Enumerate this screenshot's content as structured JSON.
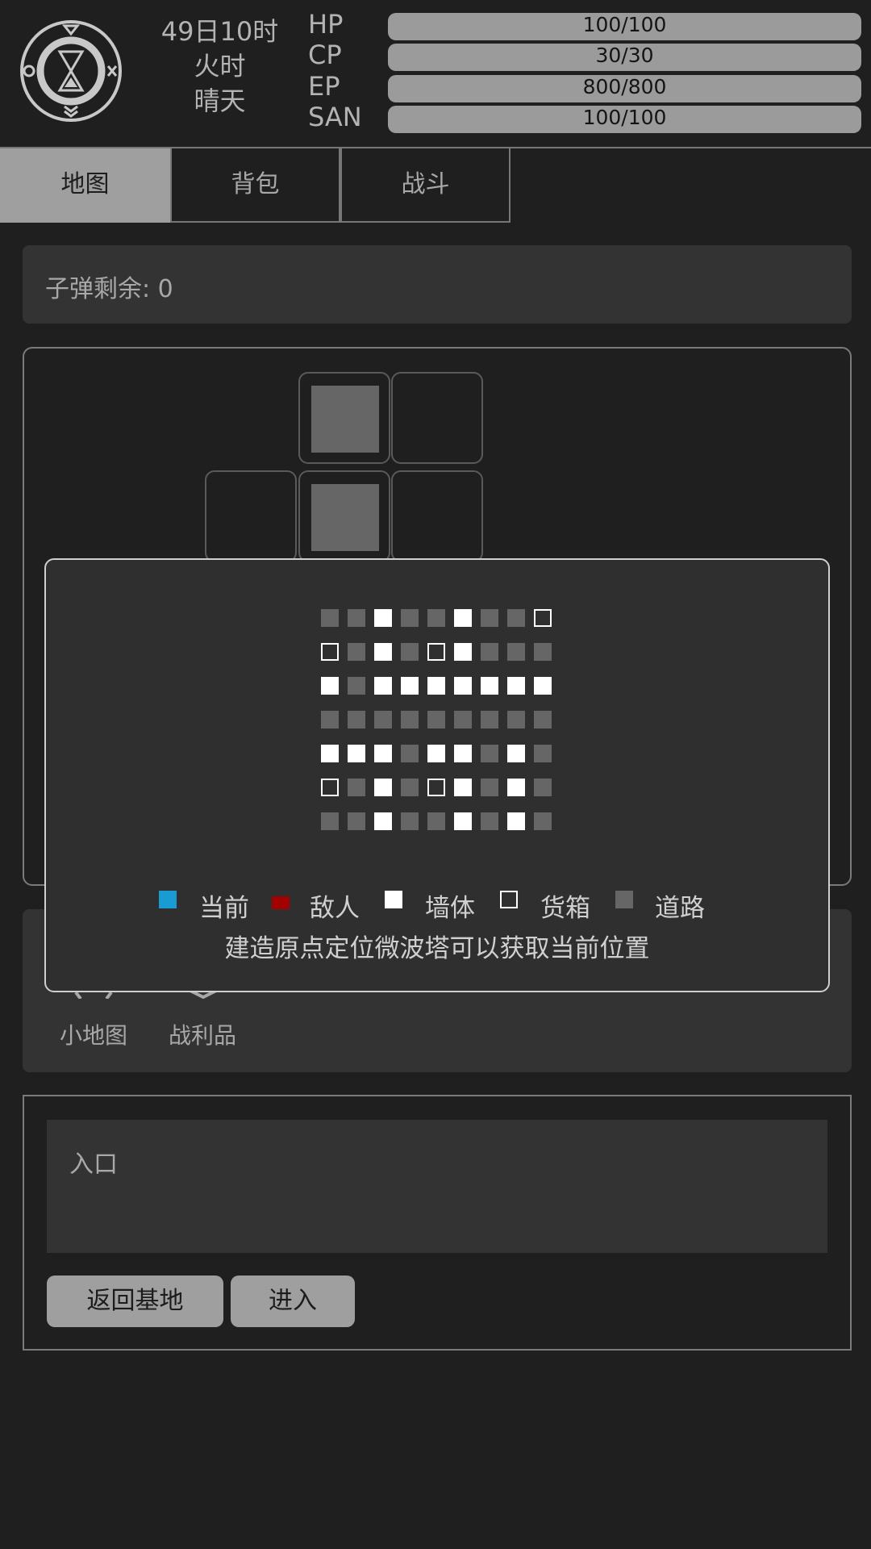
{
  "header": {
    "time": "49日10时",
    "period": "火时",
    "weather": "晴天",
    "stats": [
      {
        "label": "HP",
        "value": "100/100"
      },
      {
        "label": "CP",
        "value": "30/30"
      },
      {
        "label": "EP",
        "value": "800/800"
      },
      {
        "label": "SAN",
        "value": "100/100"
      }
    ]
  },
  "tabs": [
    {
      "label": "地图",
      "active": true
    },
    {
      "label": "背包",
      "active": false
    },
    {
      "label": "战斗",
      "active": false
    }
  ],
  "ammo": {
    "text": "子弹剩余: 0"
  },
  "tools": [
    {
      "label": "小地图",
      "icon": "map-icon"
    },
    {
      "label": "战利品",
      "icon": "loot-icon"
    }
  ],
  "entrance": {
    "text": "入口"
  },
  "buttons": {
    "return": "返回基地",
    "enter": "进入"
  },
  "modal": {
    "legend": [
      {
        "label": "当前",
        "kind": "current",
        "color": "#1a9bd1"
      },
      {
        "label": "敌人",
        "kind": "enemy",
        "color": "#a30000"
      },
      {
        "label": "墙体",
        "kind": "wall",
        "color": "#ffffff"
      },
      {
        "label": "货箱",
        "kind": "crate",
        "color": "#ffffff"
      },
      {
        "label": "道路",
        "kind": "road",
        "color": "#666666"
      }
    ],
    "hint": "建造原点定位微波塔可以获取当前位置",
    "grid": [
      [
        "road",
        "road",
        "wall",
        "road",
        "road",
        "wall",
        "road",
        "road",
        "crate"
      ],
      [
        "crate",
        "road",
        "wall",
        "road",
        "crate",
        "wall",
        "road",
        "road",
        "road"
      ],
      [
        "wall",
        "road",
        "wall",
        "wall",
        "wall",
        "wall",
        "wall",
        "wall",
        "wall"
      ],
      [
        "road",
        "road",
        "road",
        "road",
        "road",
        "road",
        "road",
        "road",
        "road"
      ],
      [
        "wall",
        "wall",
        "wall",
        "road",
        "wall",
        "wall",
        "road",
        "wall",
        "road"
      ],
      [
        "crate",
        "road",
        "wall",
        "road",
        "crate",
        "wall",
        "road",
        "wall",
        "road"
      ],
      [
        "road",
        "road",
        "wall",
        "road",
        "road",
        "wall",
        "road",
        "wall",
        "road"
      ]
    ]
  }
}
